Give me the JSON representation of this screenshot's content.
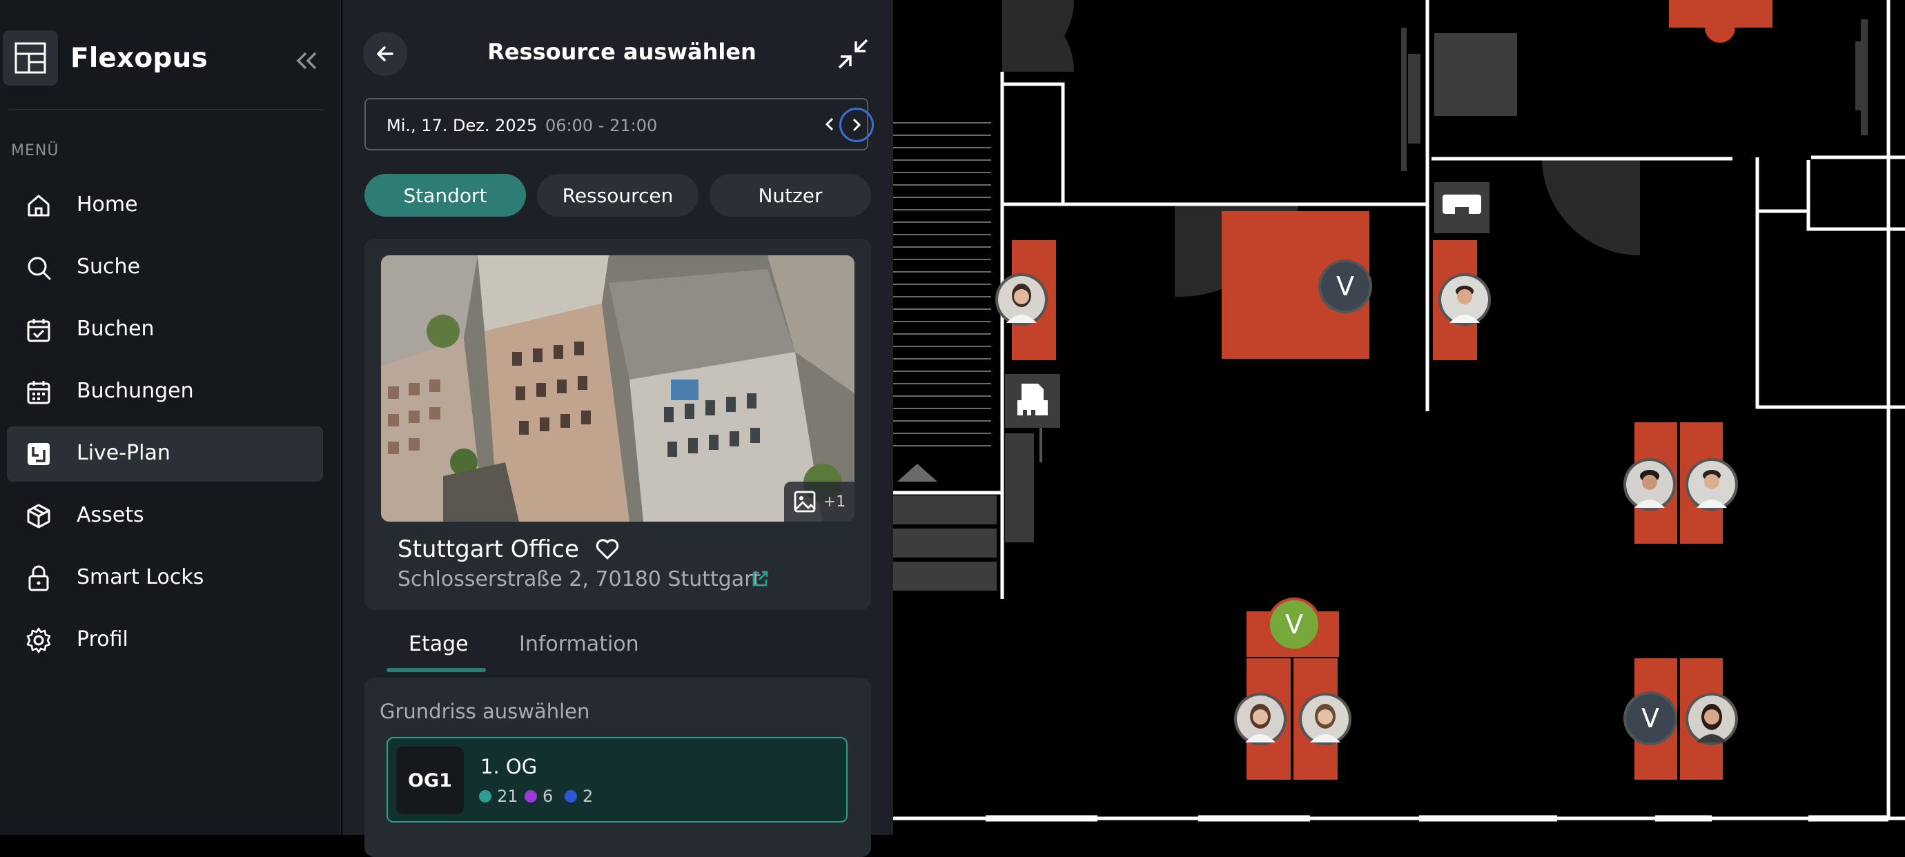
{
  "app": {
    "name": "Flexopus"
  },
  "sidebar": {
    "menu_label": "MENÜ",
    "items": [
      {
        "label": "Home",
        "icon": "home-icon"
      },
      {
        "label": "Suche",
        "icon": "search-icon"
      },
      {
        "label": "Buchen",
        "icon": "calendar-check-icon"
      },
      {
        "label": "Buchungen",
        "icon": "calendar-icon"
      },
      {
        "label": "Live-Plan",
        "icon": "live-plan-icon",
        "active": true
      },
      {
        "label": "Assets",
        "icon": "box-icon"
      },
      {
        "label": "Smart Locks",
        "icon": "lock-icon"
      },
      {
        "label": "Profil",
        "icon": "gear-icon"
      }
    ]
  },
  "panel": {
    "title": "Ressource auswählen",
    "date": "Mi., 17. Dez. 2025",
    "time": "06:00 - 21:00",
    "segments": [
      "Standort",
      "Ressourcen",
      "Nutzer"
    ],
    "active_segment": "Standort",
    "location": {
      "name": "Stuttgart Office",
      "address": "Schlosserstraße 2, 70180 Stuttgart",
      "photo_count": "+1"
    },
    "tabs": [
      "Etage",
      "Information"
    ],
    "active_tab": "Etage",
    "floor_section_label": "Grundriss auswählen",
    "floor": {
      "code": "OG1",
      "name": "1. OG",
      "counts": [
        {
          "value": "21",
          "color": "#2d9d90"
        },
        {
          "value": "6",
          "color": "#9b3bd6"
        },
        {
          "value": "2",
          "color": "#2f56d6"
        }
      ]
    }
  },
  "map": {
    "desk_color": "#c2422a",
    "avatar_letter": "V",
    "avatar_free_color": "#76a93a",
    "avatar_guest_color": "#3d4650"
  }
}
